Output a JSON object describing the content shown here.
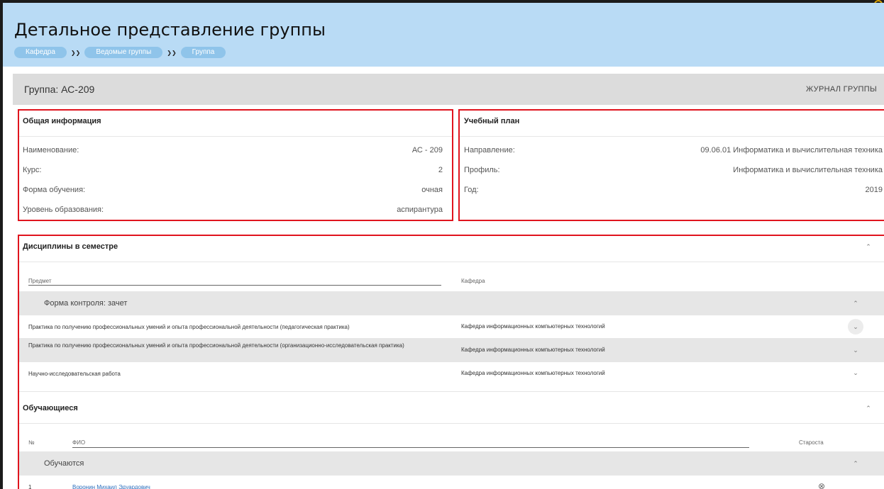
{
  "header": {
    "title": "Детальное представление группы",
    "breadcrumbs": [
      "Кафедра",
      "Ведомые группы",
      "Группа"
    ]
  },
  "group": {
    "name": "Группа: АС-209",
    "journal_label": "ЖУРНАЛ ГРУППЫ"
  },
  "general": {
    "title": "Общая информация",
    "rows": [
      {
        "label": "Наименование:",
        "value": "АС - 209"
      },
      {
        "label": "Курс:",
        "value": "2"
      },
      {
        "label": "Форма обучения:",
        "value": "очная"
      },
      {
        "label": "Уровень образования:",
        "value": "аспирантура"
      }
    ]
  },
  "plan": {
    "title": "Учебный план",
    "rows": [
      {
        "label": "Направление:",
        "value": "09.06.01 Информатика и вычислительная техника"
      },
      {
        "label": "Профиль:",
        "value": "Информатика и вычислительная техника"
      },
      {
        "label": "Год:",
        "value": "2019"
      }
    ]
  },
  "disciplines": {
    "title": "Дисциплины в семестре",
    "col_subject": "Предмет",
    "col_department": "Кафедра",
    "group_label": "Форма контроля: зачет",
    "items": [
      {
        "name": "Практика по получению профессиональных умений и опыта профессиональной деятельности (педагогическая практика)",
        "department": "Кафедра информационных компьютерных технологий"
      },
      {
        "name": "Практика по получению профессиональных умений и опыта профессиональной деятельности (организационно-исследовательская практика)",
        "department": "Кафедра информационных компьютерных технологий"
      },
      {
        "name": "Научно-исследовательская работа",
        "department": "Кафедра информационных компьютерных технологий"
      }
    ]
  },
  "students": {
    "title": "Обучающиеся",
    "col_num": "№",
    "col_fio": "ФИО",
    "col_head": "Староста",
    "group_label": "Обучаются",
    "items": [
      {
        "num": "1",
        "fio": "Воронин Михаил Эдуардович"
      }
    ]
  },
  "icons": {
    "chevron_up": "chevron-up-icon",
    "chevron_down": "chevron-down-icon",
    "breadcrumb_sep": "double-chevron-right-icon",
    "remove": "circle-x-icon"
  },
  "colors": {
    "header_bg": "#b9dbf5",
    "crumb_bg": "#8fc4ea",
    "highlight": "#e0141e",
    "group_bar": "#dcdcdc",
    "link": "#2a6ebd"
  }
}
